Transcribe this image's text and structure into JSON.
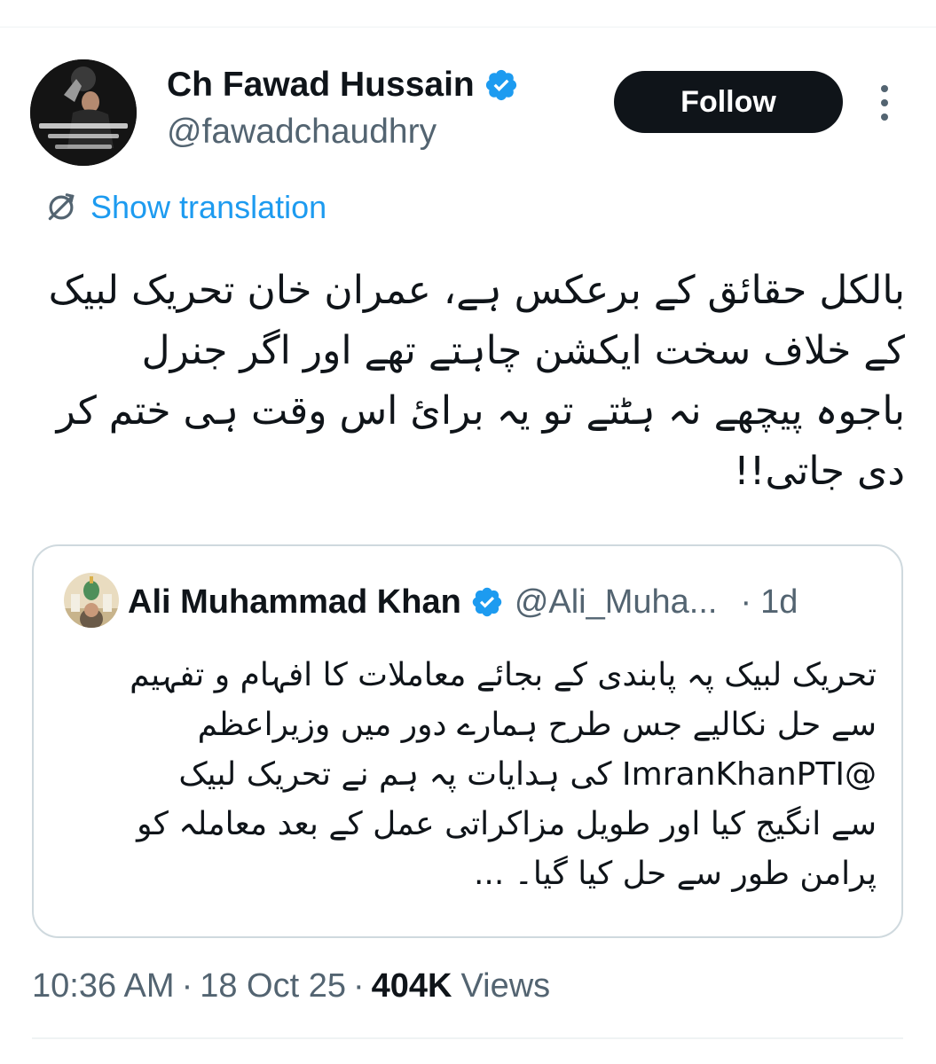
{
  "author": {
    "name": "Ch Fawad Hussain",
    "handle": "@fawadchaudhry",
    "verified": true,
    "avatar_icon": "profile-photo"
  },
  "actions": {
    "follow_label": "Follow",
    "more_icon": "more-vertical-icon"
  },
  "translation": {
    "label": "Show translation",
    "icon": "translate-icon"
  },
  "tweet": {
    "lines": [
      "بالکل حقائق کے برعکس ہے، عمران خان تحریک لبیک",
      "کے خلاف سخت ایکشن چاہتے تھے اور اگر جنرل",
      "باجوہ پیچھے نہ ہٹتے تو یہ برائ اس وقت ہی ختم کر",
      "دی جاتی!!"
    ]
  },
  "quoted": {
    "name": "Ali Muhammad Khan",
    "handle": "@Ali_Muha...",
    "separator": "·",
    "time": "1d",
    "verified": true,
    "lines": [
      "تحریک لبیک پہ پابندی کے بجائے معاملات کا افہام و تفہیم",
      "سے حل نکالیے جس طرح ہمارے دور میں وزیراعظم",
      "@ImranKhanPTI کی ہدایات پہ  ہم نے تحریک لبیک",
      "سے انگیج کیا اور طویل مزاکراتی عمل کے بعد معاملہ کو",
      "پرامن طور سے حل کیا گیا۔ ..."
    ]
  },
  "meta": {
    "time": "10:36 AM",
    "sep1": "·",
    "date": "18 Oct 25",
    "sep2": "·",
    "views_count": "404K",
    "views_label": "Views"
  },
  "colors": {
    "accent": "#1d9bf0",
    "text": "#0f1419",
    "secondary": "#536471",
    "border": "#cfd9de",
    "button_bg": "#0f1419"
  }
}
